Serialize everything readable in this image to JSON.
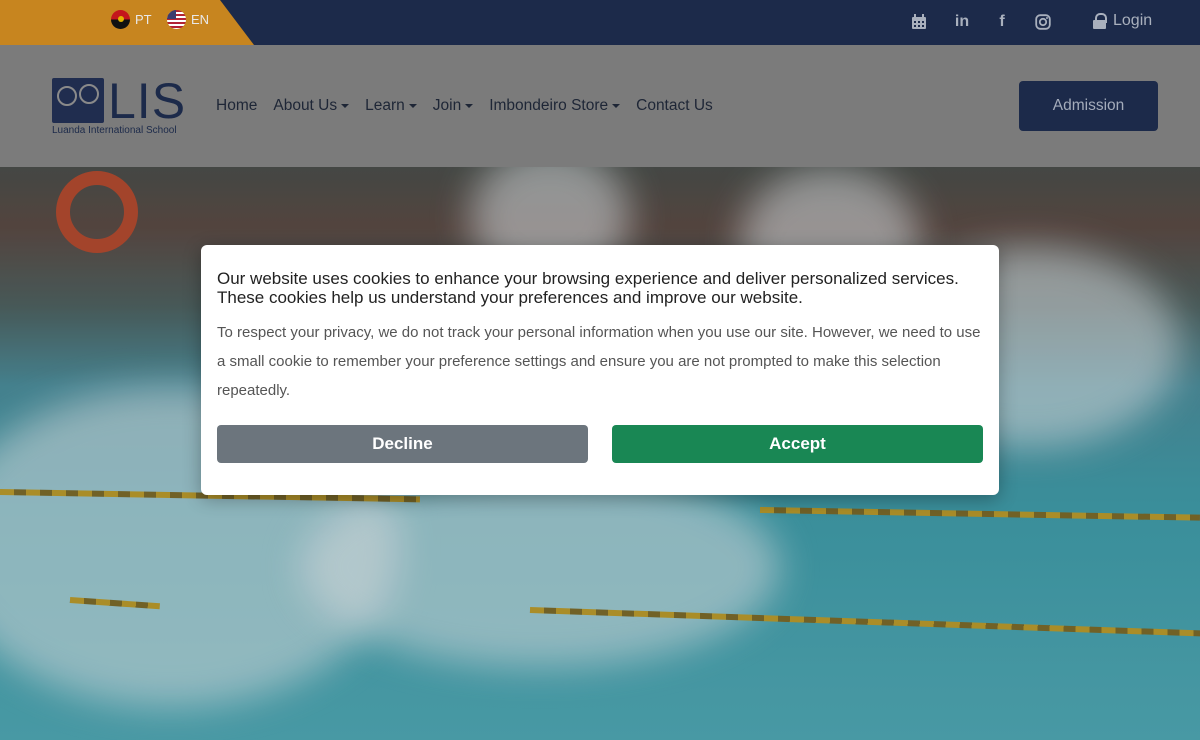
{
  "topbar": {
    "languages": [
      {
        "code": "PT",
        "flag": "angola-flag-icon"
      },
      {
        "code": "EN",
        "flag": "usa-flag-icon"
      }
    ],
    "social_icons": [
      "calendar-icon",
      "linkedin-icon",
      "facebook-icon",
      "instagram-icon"
    ],
    "login_label": "Login"
  },
  "header": {
    "logo_text": "LIS",
    "logo_subtitle": "Luanda International School",
    "nav": [
      {
        "label": "Home",
        "dropdown": false
      },
      {
        "label": "About Us",
        "dropdown": true
      },
      {
        "label": "Learn",
        "dropdown": true
      },
      {
        "label": "Join",
        "dropdown": true
      },
      {
        "label": "Imbondeiro Store",
        "dropdown": true
      },
      {
        "label": "Contact Us",
        "dropdown": false
      }
    ],
    "admission_label": "Admission"
  },
  "cookie_modal": {
    "lead": "Our website uses cookies to enhance your browsing experience and deliver personalized services. These cookies help us understand your preferences and improve our website.",
    "body": "To respect your privacy, we do not track your personal information when you use our site. However, we need to use a small cookie to remember your preference settings and ensure you are not prompted to make this selection repeatedly.",
    "decline_label": "Decline",
    "accept_label": "Accept"
  },
  "colors": {
    "navy": "#1c2a4a",
    "orange": "#c7851f",
    "decline": "#6c757d",
    "accept": "#198754"
  }
}
